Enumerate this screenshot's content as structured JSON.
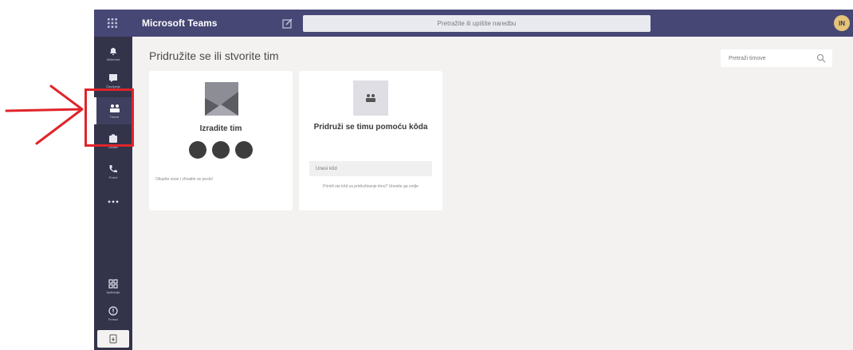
{
  "topbar": {
    "app_title": "Microsoft Teams",
    "search_placeholder": "Pretražite ili upišite naredbu",
    "avatar_initials": "IN",
    "color": "#464775"
  },
  "rail": {
    "items": [
      {
        "label": "Aktivnost",
        "icon": "bell-icon"
      },
      {
        "label": "Čavrljanje",
        "icon": "chat-icon"
      },
      {
        "label": "Timovi",
        "icon": "teams-icon"
      },
      {
        "label": "Zadaci",
        "icon": "assignments-icon"
      },
      {
        "label": "Pozivi",
        "icon": "phone-icon"
      },
      {
        "label": "",
        "icon": "more-icon"
      }
    ],
    "bottom_items": [
      {
        "label": "Aplikacije",
        "icon": "apps-icon"
      },
      {
        "label": "Pomoć",
        "icon": "help-icon"
      }
    ],
    "color": "#33344a"
  },
  "main": {
    "title": "Pridružite se ili stvorite tim",
    "team_search_placeholder": "Pretraži timove"
  },
  "cards": {
    "create": {
      "title": "Izradite tim",
      "caption": "Okupite osoe i zhvatite se posla!"
    },
    "join": {
      "title": "Pridruži se timu pomoću kôda",
      "input_placeholder": "Unesi kôd",
      "caption": "Primili ste kôd za pridruživanje timu? Unesite ga ovdje"
    }
  },
  "annotation": {
    "color": "#e0242a"
  }
}
